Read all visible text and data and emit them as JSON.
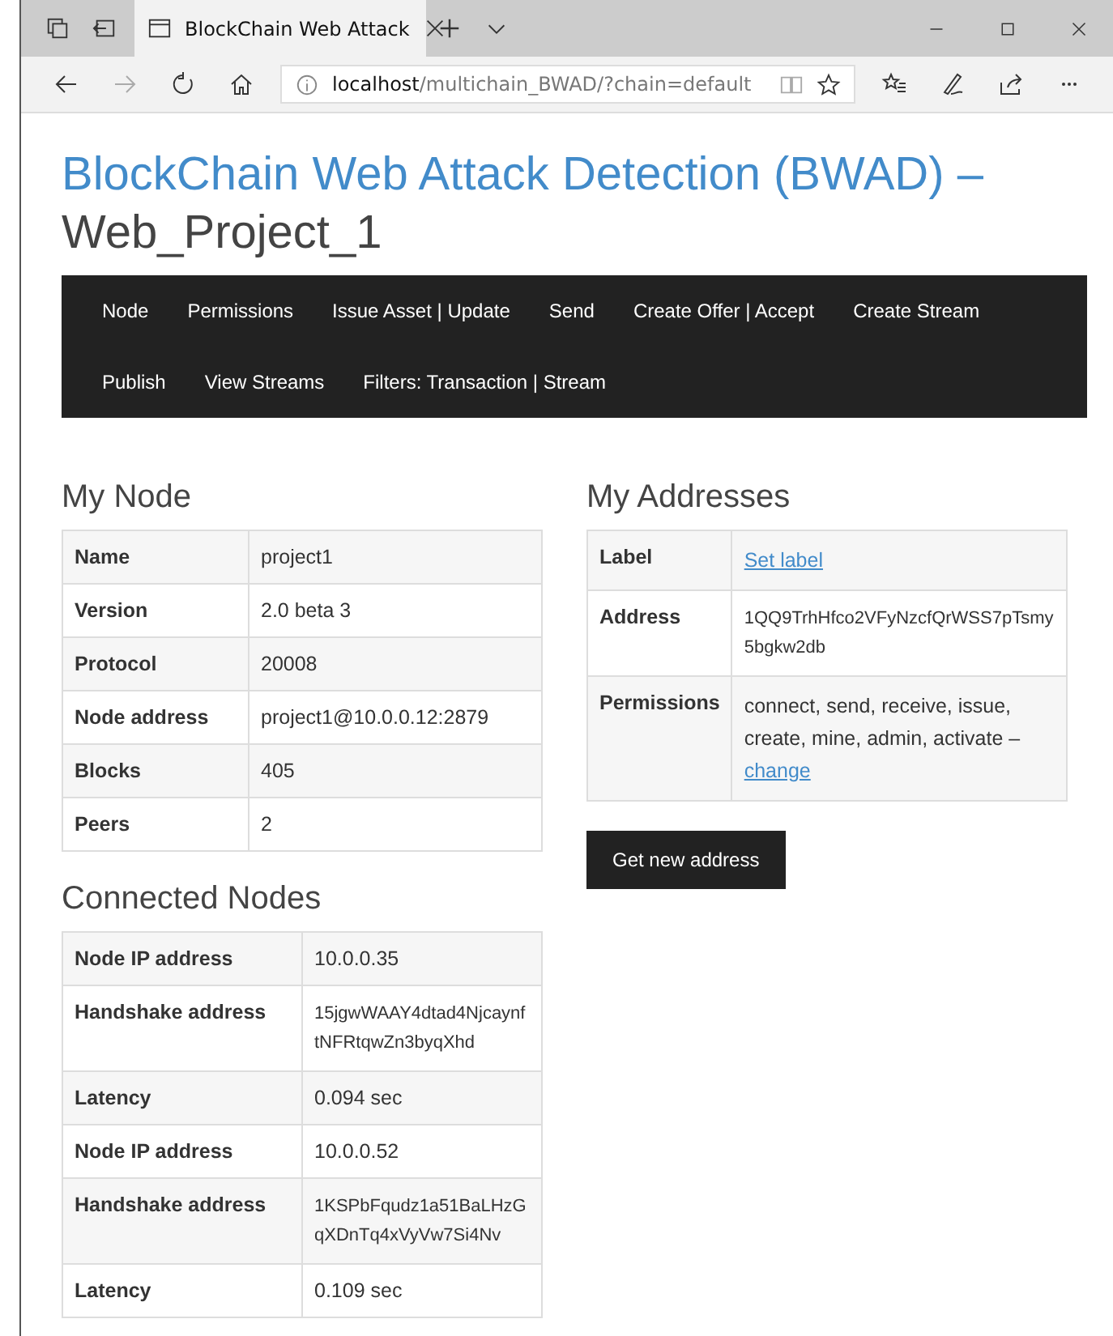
{
  "browser": {
    "tab_title": "BlockChain Web Attack",
    "url_host": "localhost",
    "url_path": "/multichain_BWAD/?chain=default"
  },
  "title": {
    "main": "BlockChain Web Attack Detection (BWAD) –",
    "sub": "Web_Project_1"
  },
  "nav": [
    [
      "Node",
      "Permissions",
      "Issue Asset | Update",
      "Send",
      "Create Offer | Accept",
      "Create Stream"
    ],
    [
      "Publish",
      "View Streams",
      "Filters: Transaction | Stream"
    ]
  ],
  "my_node": {
    "heading": "My Node",
    "rows": [
      {
        "label": "Name",
        "value": "project1"
      },
      {
        "label": "Version",
        "value": "2.0 beta 3"
      },
      {
        "label": "Protocol",
        "value": "20008"
      },
      {
        "label": "Node address",
        "value": "project1@10.0.0.12:2879"
      },
      {
        "label": "Blocks",
        "value": "405"
      },
      {
        "label": "Peers",
        "value": "2"
      }
    ]
  },
  "connected_nodes": {
    "heading": "Connected Nodes",
    "rows": [
      {
        "label": "Node IP address",
        "value": "10.0.0.35",
        "kind": "text"
      },
      {
        "label": "Handshake address",
        "value": "15jgwWAAY4dtad4NjcaynftNFRtqwZn3byqXhd",
        "kind": "hash"
      },
      {
        "label": "Latency",
        "value": "0.094 sec",
        "kind": "text"
      },
      {
        "label": "Node IP address",
        "value": "10.0.0.52",
        "kind": "text"
      },
      {
        "label": "Handshake address",
        "value": "1KSPbFqudz1a51BaLHzGqXDnTq4xVyVw7Si4Nv",
        "kind": "hash"
      },
      {
        "label": "Latency",
        "value": "0.109 sec",
        "kind": "text"
      }
    ]
  },
  "my_addresses": {
    "heading": "My Addresses",
    "rows": [
      {
        "label": "Label",
        "kind": "link",
        "link": "Set label"
      },
      {
        "label": "Address",
        "kind": "hash",
        "value": "1QQ9TrhHfco2VFyNzcfQrWSS7pTsmy5bgkw2db"
      },
      {
        "label": "Permissions",
        "kind": "text_link",
        "value": "connect, send, receive, issue, create, mine, admin, activate –",
        "link": "change"
      }
    ]
  },
  "button": "Get new address"
}
